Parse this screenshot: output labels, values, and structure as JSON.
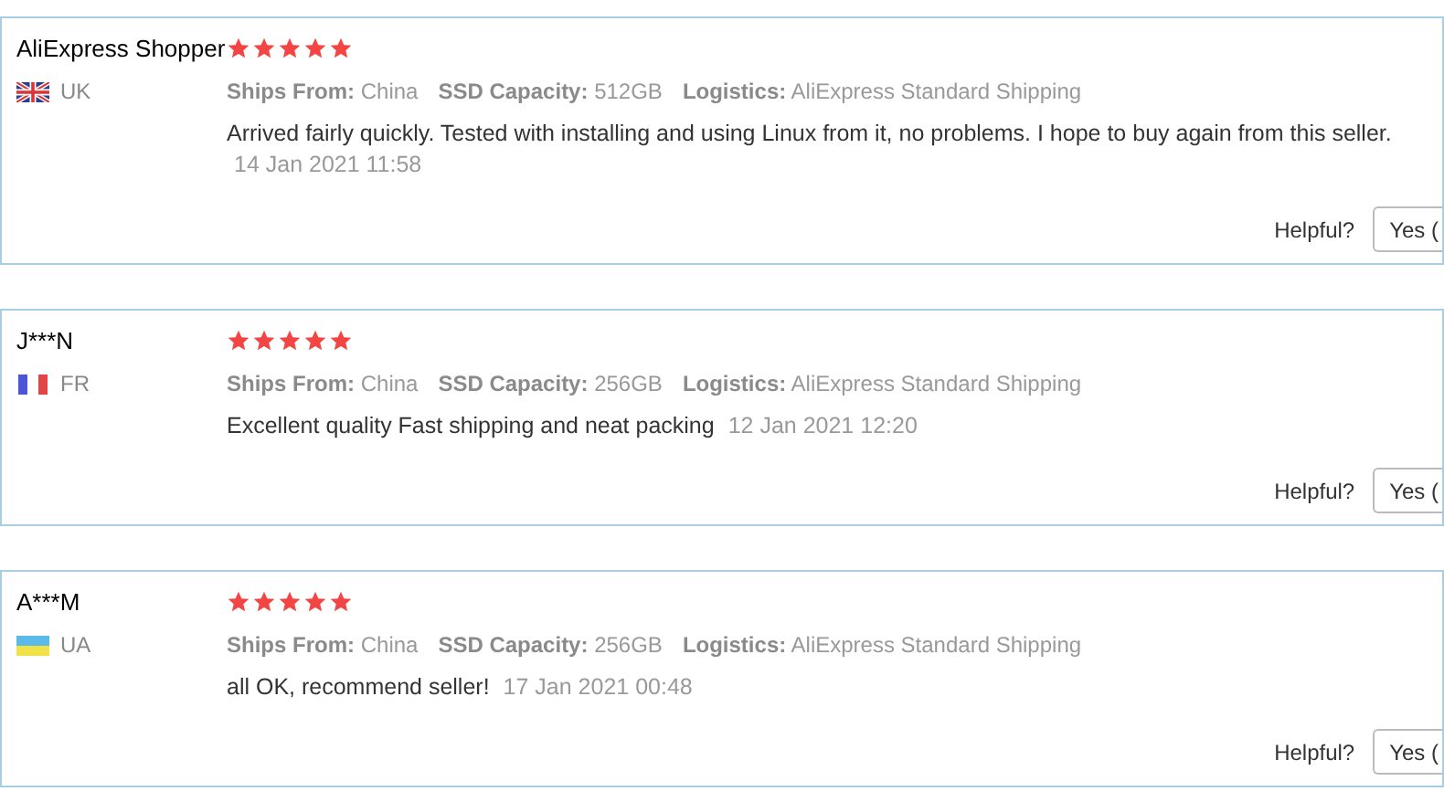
{
  "reviews": [
    {
      "name": "AliExpress Shopper",
      "country": {
        "code": "UK",
        "kind": "uk"
      },
      "stars": 5,
      "specs": [
        {
          "label": "Ships From:",
          "value": "China"
        },
        {
          "label": "SSD Capacity:",
          "value": "512GB"
        },
        {
          "label": "Logistics:",
          "value": "AliExpress Standard Shipping"
        }
      ],
      "text": "Arrived fairly quickly. Tested with installing and using Linux from it, no problems. I hope to buy again from this seller.",
      "date": "14 Jan 2021 11:58",
      "helpful_label": "Helpful?",
      "yes_button": "Yes ("
    },
    {
      "name": "J***N",
      "country": {
        "code": "FR",
        "kind": "fr"
      },
      "stars": 5,
      "specs": [
        {
          "label": "Ships From:",
          "value": "China"
        },
        {
          "label": "SSD Capacity:",
          "value": "256GB"
        },
        {
          "label": "Logistics:",
          "value": "AliExpress Standard Shipping"
        }
      ],
      "text": "Excellent quality Fast shipping and neat packing",
      "date": "12 Jan 2021 12:20",
      "helpful_label": "Helpful?",
      "yes_button": "Yes ("
    },
    {
      "name": "A***M",
      "country": {
        "code": "UA",
        "kind": "ua"
      },
      "stars": 5,
      "specs": [
        {
          "label": "Ships From:",
          "value": "China"
        },
        {
          "label": "SSD Capacity:",
          "value": "256GB"
        },
        {
          "label": "Logistics:",
          "value": "AliExpress Standard Shipping"
        }
      ],
      "text": "all OK, recommend seller!",
      "date": "17 Jan 2021 00:48",
      "helpful_label": "Helpful?",
      "yes_button": "Yes ("
    }
  ]
}
